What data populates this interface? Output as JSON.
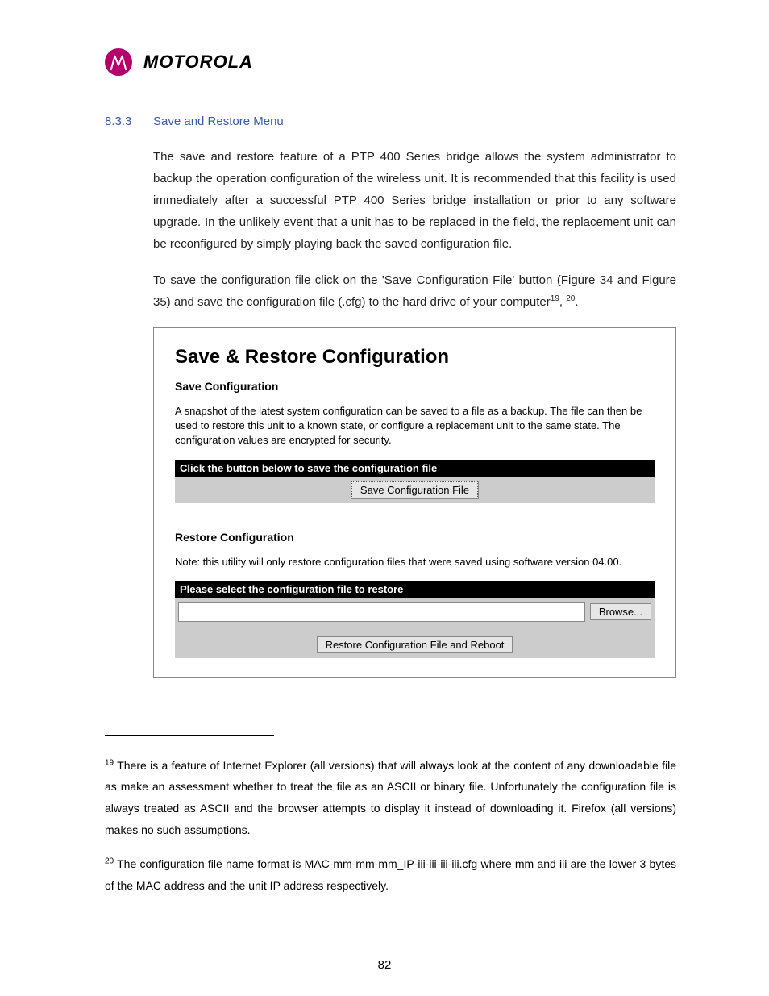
{
  "header": {
    "brand": "MOTOROLA"
  },
  "section": {
    "number": "8.3.3",
    "title": "Save and Restore Menu"
  },
  "para1": "The save and restore feature of a PTP 400 Series bridge allows the system administrator to backup the operation configuration of the wireless unit. It is recommended that this facility is used immediately after a successful PTP 400 Series bridge installation or prior to any software upgrade. In the unlikely event that a unit has to be replaced in the field, the replacement unit can be reconfigured by simply playing back the saved configuration file.",
  "para2_a": "To save the configuration file click on the 'Save Configuration File' button (Figure 34 and Figure 35) and save the configuration file (.cfg) to the hard drive of your computer",
  "para2_sup1": "19",
  "para2_sep": ", ",
  "para2_sup2": "20",
  "para2_end": ".",
  "screenshot": {
    "title": "Save & Restore Configuration",
    "save_subhead": "Save Configuration",
    "save_para": "A snapshot of the latest system configuration can be saved to a file as a backup. The file can then be used to restore this unit to a known state, or configure a replacement unit to the same state. The configuration values are encrypted for security.",
    "save_bar": "Click the button below to save the configuration file",
    "save_button": "Save Configuration File",
    "restore_subhead": "Restore Configuration",
    "restore_note": "Note: this utility will only restore configuration files that were saved using software version 04.00.",
    "restore_bar": "Please select the configuration file to restore",
    "browse_button": "Browse...",
    "restore_button": "Restore Configuration File and Reboot"
  },
  "footnotes": {
    "f19_sup": "19",
    "f19_text": " There is a feature of Internet Explorer (all versions) that will always look at the content of any downloadable file as make an assessment whether to treat the file as an ASCII or binary file. Unfortunately the configuration file is always treated as ASCII and the browser attempts to display it instead of downloading it. Firefox (all versions) makes no such assumptions.",
    "f20_sup": "20",
    "f20_text": " The configuration file name format is MAC-mm-mm-mm_IP-iii-iii-iii-iii.cfg where mm and iii are the lower 3 bytes of the MAC address and the unit IP address respectively."
  },
  "page_number": "82"
}
